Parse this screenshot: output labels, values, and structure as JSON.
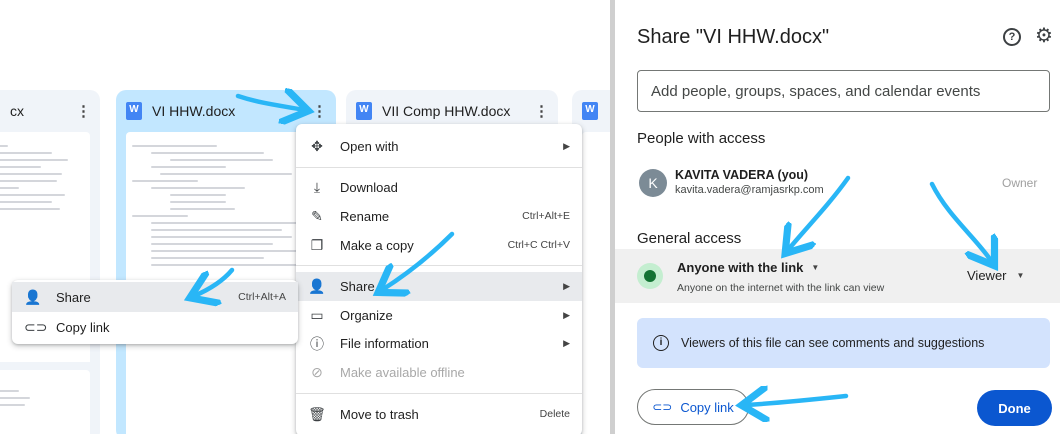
{
  "drive": {
    "cards": [
      {
        "name": "cx"
      },
      {
        "name": "VI HHW.docx"
      },
      {
        "name": "VII Comp HHW.docx"
      },
      {
        "name": ""
      }
    ],
    "more_icon": "more-vert-icon",
    "file_icon": "word-doc-icon"
  },
  "context_menu": {
    "items": [
      {
        "label": "Open with",
        "icon": "open-with-icon",
        "shortcut": "",
        "submenu": true
      },
      {
        "label": "Download",
        "icon": "download-icon",
        "shortcut": ""
      },
      {
        "label": "Rename",
        "icon": "rename-icon",
        "shortcut": "Ctrl+Alt+E"
      },
      {
        "label": "Make a copy",
        "icon": "copy-icon",
        "shortcut": "Ctrl+C Ctrl+V"
      },
      {
        "label": "Share",
        "icon": "person-add-icon",
        "shortcut": "",
        "submenu": true
      },
      {
        "label": "Organize",
        "icon": "folder-icon",
        "shortcut": "",
        "submenu": true
      },
      {
        "label": "File information",
        "icon": "info-icon",
        "shortcut": "",
        "submenu": true
      },
      {
        "label": "Make available offline",
        "icon": "offline-icon",
        "shortcut": "",
        "disabled": true
      },
      {
        "label": "Move to trash",
        "icon": "trash-icon",
        "shortcut": "Delete"
      }
    ]
  },
  "share_submenu": {
    "items": [
      {
        "label": "Share",
        "icon": "person-add-icon",
        "shortcut": "Ctrl+Alt+A"
      },
      {
        "label": "Copy link",
        "icon": "link-icon",
        "shortcut": ""
      }
    ]
  },
  "share_dialog": {
    "title": "Share \"VI HHW.docx\"",
    "add_people_placeholder": "Add people, groups, spaces, and calendar events",
    "people_heading": "People with access",
    "person": {
      "initial": "K",
      "name": "KAVITA VADERA (you)",
      "email": "kavita.vadera@ramjasrkp.com",
      "role": "Owner"
    },
    "general_heading": "General access",
    "access_level": "Anyone with the link",
    "access_desc": "Anyone on the internet with the link can view",
    "role": "Viewer",
    "banner": "Viewers of this file can see comments and suggestions",
    "copy_link": "Copy link",
    "done": "Done"
  },
  "colors": {
    "accent": "#0b57d0",
    "selected_card": "#c2e7ff",
    "banner": "#d3e3fd",
    "arrow": "#29b6f6"
  }
}
